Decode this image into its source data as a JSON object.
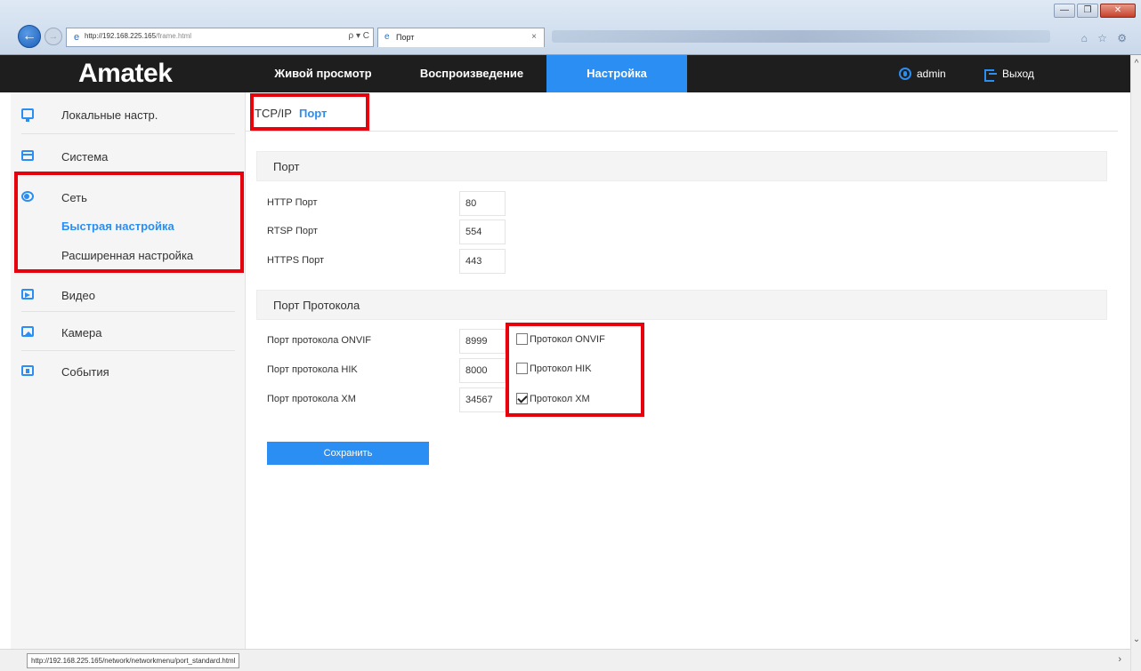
{
  "browser": {
    "url_host": "http://192.168.225.165",
    "url_path": "/frame.html",
    "tab_title": "Порт",
    "tab_close": "×",
    "search_refresh": "ρ ▾ C",
    "back_glyph": "←",
    "forward_glyph": "→",
    "window_buttons": {
      "minimize": "—",
      "maximize": "❐",
      "close": "✕"
    },
    "right_tools": "⌂ ☆ ⚙"
  },
  "header": {
    "logo": "Amatek",
    "nav": [
      {
        "label": "Живой просмотр",
        "active": false
      },
      {
        "label": "Воспроизведение",
        "active": false
      },
      {
        "label": "Настройка",
        "active": true
      }
    ],
    "user": "admin",
    "logout": "Выход",
    "accent_color": "#2a8ef2"
  },
  "sidebar": {
    "items": [
      {
        "label": "Локальные настр.",
        "icon": "monitor-icon"
      },
      {
        "label": "Система",
        "icon": "calendar-icon"
      },
      {
        "label": "Сеть",
        "icon": "globe-icon"
      },
      {
        "label": "Видео",
        "icon": "video-icon"
      },
      {
        "label": "Камера",
        "icon": "image-icon"
      },
      {
        "label": "События",
        "icon": "events-icon"
      }
    ],
    "network_submenu": [
      {
        "label": "Быстрая настройка",
        "active": true
      },
      {
        "label": "Расширенная настройка",
        "active": false
      }
    ]
  },
  "subtabs": [
    {
      "label": "TCP/IP",
      "active": false
    },
    {
      "label": "Порт",
      "active": true
    }
  ],
  "port_section": {
    "title": "Порт",
    "fields": [
      {
        "label": "HTTP Порт",
        "value": "80"
      },
      {
        "label": "RTSP Порт",
        "value": "554"
      },
      {
        "label": "HTTPS Порт",
        "value": "443"
      }
    ]
  },
  "protocol_section": {
    "title": "Порт Протокола",
    "fields": [
      {
        "label": "Порт протокола ONVIF",
        "value": "8999",
        "check_label": "Протокол ONVIF",
        "checked": false
      },
      {
        "label": "Порт протокола HIK",
        "value": "8000",
        "check_label": "Протокол HIK",
        "checked": false
      },
      {
        "label": "Порт протокола XM",
        "value": "34567",
        "check_label": "Протокол XM",
        "checked": true
      }
    ]
  },
  "save_label": "Сохранить",
  "status_url": "http://192.168.225.165/network/networkmenu/port_standard.html",
  "highlight_color": "#e8000d"
}
